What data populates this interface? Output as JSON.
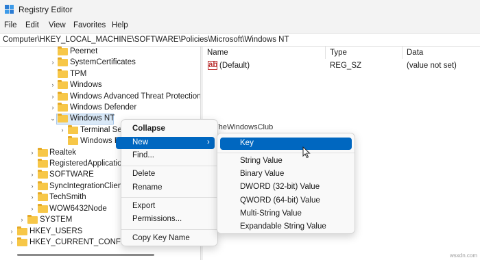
{
  "window": {
    "title": "Registry Editor"
  },
  "menu": [
    "File",
    "Edit",
    "View",
    "Favorites",
    "Help"
  ],
  "address": "Computer\\HKEY_LOCAL_MACHINE\\SOFTWARE\\Policies\\Microsoft\\Windows NT",
  "tree": [
    {
      "label": "Peernet",
      "expander": ""
    },
    {
      "label": "SystemCertificates",
      "expander": "›"
    },
    {
      "label": "TPM",
      "expander": ""
    },
    {
      "label": "Windows",
      "expander": "›"
    },
    {
      "label": "Windows Advanced Threat Protection",
      "expander": "›"
    },
    {
      "label": "Windows Defender",
      "expander": "›"
    },
    {
      "label": "Windows NT",
      "expander": "⌄"
    },
    {
      "label": "Terminal Services",
      "expander": "›"
    },
    {
      "label": "Windows File Protection",
      "expander": ""
    },
    {
      "label": "Realtek",
      "expander": "›"
    },
    {
      "label": "RegisteredApplications",
      "expander": ""
    },
    {
      "label": "SOFTWARE",
      "expander": "›"
    },
    {
      "label": "SyncIntegrationClients",
      "expander": "›"
    },
    {
      "label": "TechSmith",
      "expander": "›"
    },
    {
      "label": "WOW6432Node",
      "expander": "›"
    },
    {
      "label": "SYSTEM",
      "expander": "›"
    },
    {
      "label": "HKEY_USERS",
      "expander": "›"
    },
    {
      "label": "HKEY_CURRENT_CONFIG",
      "expander": "›"
    }
  ],
  "columns": {
    "name": "Name",
    "type": "Type",
    "data": "Data"
  },
  "values": [
    {
      "icon": "ab",
      "name": "(Default)",
      "type": "REG_SZ",
      "data": "(value not set)"
    }
  ],
  "watermark": "TheWindowsClub",
  "context_menu": {
    "items": [
      "Collapse",
      "New",
      "Find...",
      "Delete",
      "Rename",
      "Export",
      "Permissions...",
      "Copy Key Name"
    ],
    "highlighted": "New"
  },
  "submenu": {
    "items": [
      "Key",
      "String Value",
      "Binary Value",
      "DWORD (32-bit) Value",
      "QWORD (64-bit) Value",
      "Multi-String Value",
      "Expandable String Value"
    ],
    "highlighted": "Key"
  },
  "footer_mark": "wsxdn.com",
  "colors": {
    "accent": "#0067c0",
    "folder": "#f7c748",
    "selection": "#d9e8f7"
  }
}
